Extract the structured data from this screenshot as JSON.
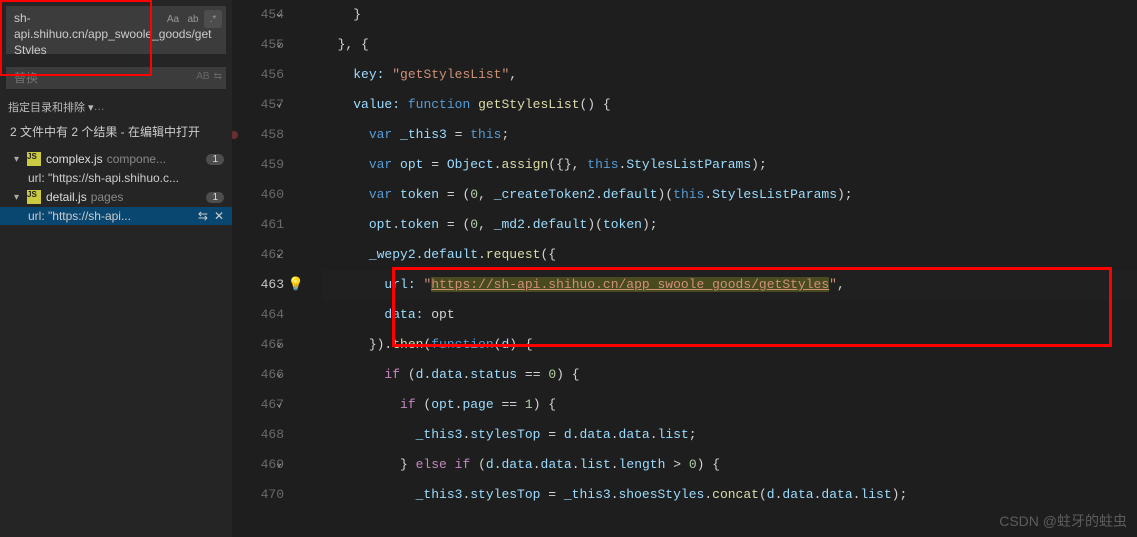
{
  "search": {
    "value": "sh-api.shihuo.cn/app_swoole_goods/getStyles",
    "case_label": "Aa",
    "word_label": "ab",
    "regex_label": ".*"
  },
  "replace": {
    "placeholder": "替换",
    "preserve_label": "AB",
    "swap_icon": "⇆"
  },
  "filter": {
    "label": "指定目录和排除 ▾",
    "dots": "…"
  },
  "results": {
    "summary": "2 文件中有 2 个结果 - 在编辑中打开"
  },
  "tree": {
    "files": [
      {
        "name": "complex.js",
        "path": "compone...",
        "count": "1",
        "matches": [
          {
            "text": "url: \"https://sh-api.shihuo.c...",
            "active": false
          }
        ]
      },
      {
        "name": "detail.js",
        "path": "pages",
        "count": "1",
        "matches": [
          {
            "text": "url: \"https://sh-api...",
            "active": true,
            "actions": true
          }
        ]
      }
    ]
  },
  "editor": {
    "lines": [
      {
        "n": "454",
        "chev": true
      },
      {
        "n": "455",
        "chev": true
      },
      {
        "n": "456"
      },
      {
        "n": "457",
        "chev": true
      },
      {
        "n": "458",
        "bp": true
      },
      {
        "n": "459"
      },
      {
        "n": "460"
      },
      {
        "n": "461"
      },
      {
        "n": "462",
        "chev": true
      },
      {
        "n": "463",
        "cur": true,
        "bulb": true
      },
      {
        "n": "464"
      },
      {
        "n": "465",
        "chev": true
      },
      {
        "n": "466",
        "chev": true
      },
      {
        "n": "467",
        "chev": true
      },
      {
        "n": "468"
      },
      {
        "n": "469",
        "chev": true
      },
      {
        "n": "470"
      }
    ]
  },
  "code": {
    "l454": {
      "brace": "}"
    },
    "l455": {
      "br": "}, {"
    },
    "l456": {
      "key": "key:",
      "val": "\"getStylesList\"",
      "c": ","
    },
    "l457": {
      "key": "value:",
      "fn": "function",
      "name": "getStylesList",
      "p": "() {"
    },
    "l458": {
      "var": "var",
      "id": "_this3",
      "eq": " = ",
      "th": "this",
      "sc": ";"
    },
    "l459": {
      "var": "var",
      "id": "opt",
      "eq": " = ",
      "obj": "Object",
      "dot": ".",
      "m": "assign",
      "args": "({}, ",
      "th": "this",
      "dot2": ".",
      "p2": "StylesListParams",
      "end": ");"
    },
    "l460": {
      "var": "var",
      "id": "token",
      "eq": " = (",
      "n0": "0",
      "c": ", ",
      "o": "_createToken2",
      "d": ".",
      "df": "default",
      "p": ")(",
      "th": "this",
      "d2": ".",
      "p2": "StylesListParams",
      "e": ");"
    },
    "l461": {
      "o": "opt",
      "d": ".",
      "p": "token",
      "eq": " = (",
      "n0": "0",
      "c": ", ",
      "o2": "_md2",
      "d2": ".",
      "df": "default",
      "p2": ")(",
      "t": "token",
      "e": ");"
    },
    "l462": {
      "o": "_wepy2",
      "d": ".",
      "df": "default",
      "d2": ".",
      "m": "request",
      "p": "({"
    },
    "l463": {
      "k": "url:",
      "sp": " ",
      "q1": "\"",
      "url": "https://sh-api.shihuo.cn/app_swoole_goods/getStyles",
      "q2": "\"",
      "c": ","
    },
    "l464": {
      "k": "data:",
      "v": " opt"
    },
    "l465": {
      "br": "}).",
      "m": "then",
      "p": "(",
      "fn": "function",
      "args": "(",
      "d": "d",
      "e": ") {"
    },
    "l466": {
      "if": "if",
      "p": " (",
      "d": "d",
      "dot": ".",
      "dat": "data",
      "dot2": ".",
      "st": "status",
      "eq": " == ",
      "n0": "0",
      "e": ") {"
    },
    "l467": {
      "if": "if",
      "p": " (",
      "o": "opt",
      "dot": ".",
      "pg": "page",
      "eq": " == ",
      "n1": "1",
      "e": ") {"
    },
    "l468": {
      "o": "_this3",
      "d": ".",
      "p": "stylesTop",
      "eq": " = ",
      "dd": "d",
      "d2": ".",
      "dat": "data",
      "d3": ".",
      "dat2": "data",
      "d4": ".",
      "lst": "list",
      "sc": ";"
    },
    "l469": {
      "br": "} ",
      "el": "else",
      "sp": " ",
      "if": "if",
      "p": " (",
      "d": "d",
      "dot": ".",
      "dat": "data",
      "d2": ".",
      "dat2": "data",
      "d3": ".",
      "lst": "list",
      "d4": ".",
      "len": "length",
      "gt": " > ",
      "n0": "0",
      "e": ") {"
    },
    "l470": {
      "o": "_this3",
      "d": ".",
      "p": "stylesTop",
      "eq": " = ",
      "o2": "_this3",
      "d2": ".",
      "p2": "shoesStyles",
      "d3": ".",
      "m": "concat",
      "args": "(",
      "dd": "d",
      "d4": ".",
      "dat": "data",
      "d5": ".",
      "dat2": "data",
      "d6": ".",
      "lst": "list",
      "e": ");"
    }
  },
  "watermark": "CSDN @蛀牙的蛀虫"
}
